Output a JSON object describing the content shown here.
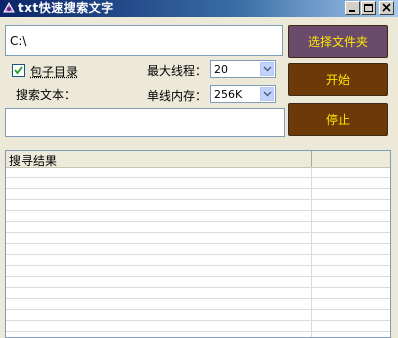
{
  "window": {
    "title": "txt快速搜索文字",
    "minimize": "_",
    "maximize": "□",
    "close": "×"
  },
  "form": {
    "path_value": "C:\\",
    "include_subdirs_label": "包子目录",
    "include_subdirs_checked": true,
    "search_text_label": "搜索文本：",
    "search_text_value": "",
    "max_threads_label": "最大线程：",
    "max_threads_value": "20",
    "thread_memory_label": "单线内存：",
    "thread_memory_value": "256K"
  },
  "buttons": {
    "browse": "选择文件夹",
    "start": "开始",
    "stop": "停止"
  },
  "results": {
    "columns": [
      "搜寻结果",
      ""
    ],
    "rows": []
  },
  "colors": {
    "button_text": "#ffe600",
    "browse_bg": "#6b4b6b",
    "action_bg": "#6b3a08"
  }
}
